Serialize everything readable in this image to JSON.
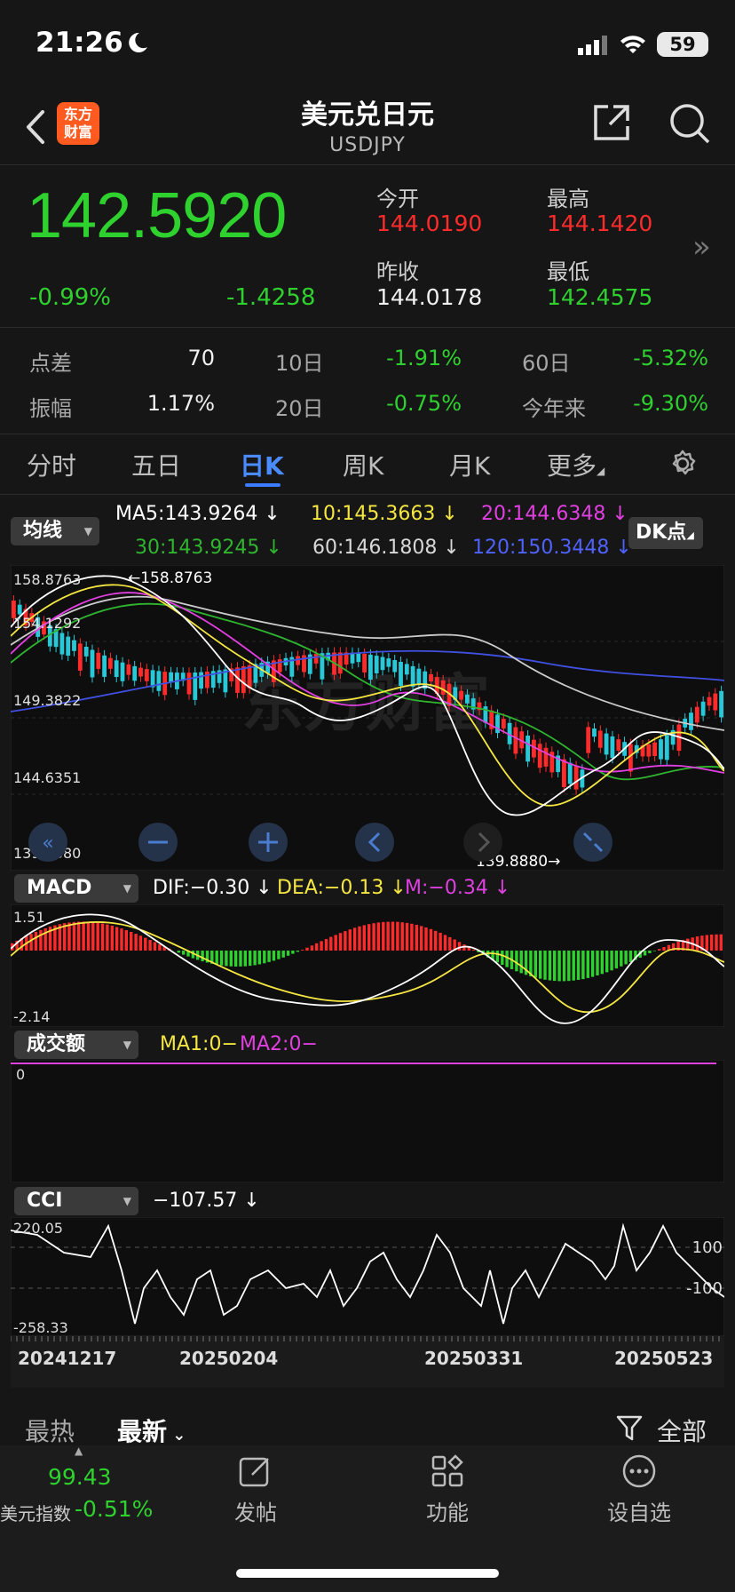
{
  "status": {
    "time": "21:26",
    "battery": "59"
  },
  "header": {
    "title": "美元兑日元",
    "subtitle": "USDJPY",
    "logo_line1": "东方",
    "logo_line2": "财富"
  },
  "quote": {
    "price": "142.5920",
    "change_pct": "-0.99%",
    "change": "-1.4258",
    "open_label": "今开",
    "open": "144.0190",
    "high_label": "最高",
    "high": "144.1420",
    "prev_close_label": "昨收",
    "prev_close": "144.0178",
    "low_label": "最低",
    "low": "142.4575"
  },
  "stats": [
    {
      "label": "点差",
      "value": "70"
    },
    {
      "label": "10日",
      "value": "-1.91%"
    },
    {
      "label": "60日",
      "value": "-5.32%"
    },
    {
      "label": "振幅",
      "value": "1.17%"
    },
    {
      "label": "20日",
      "value": "-0.75%"
    },
    {
      "label": "今年来",
      "value": "-9.30%"
    }
  ],
  "tabs": [
    "分时",
    "五日",
    "日K",
    "周K",
    "月K",
    "更多"
  ],
  "active_tab": "日K",
  "ma": {
    "selector": "均线",
    "ma5": "MA5:143.9264",
    "ma10": "10:145.3663",
    "ma20": "20:144.6348",
    "ma30": "30:143.9245",
    "ma60": "60:146.1808",
    "ma120": "120:150.3448",
    "dk_button": "DK点"
  },
  "main_chart": {
    "y_labels": [
      "158.8763",
      "154.1292",
      "149.3822",
      "144.6351",
      "139.8880"
    ],
    "max_marker": "←158.8763",
    "min_marker": "139.8880→"
  },
  "macd": {
    "selector": "MACD",
    "dif": "DIF:−0.30",
    "dea": "DEA:−0.13",
    "m": "M:−0.34",
    "y_top": "1.51",
    "y_bottom": "-2.14"
  },
  "volume": {
    "selector": "成交额",
    "ma1": "MA1:0−",
    "ma2": "MA2:0−",
    "zero": "0"
  },
  "cci": {
    "selector": "CCI",
    "value": "−107.57",
    "y_top": "220.05",
    "y_bottom": "-258.33",
    "level_upper": "100",
    "level_lower": "-100"
  },
  "dates": [
    "20241217",
    "20250204",
    "20250331",
    "20250523"
  ],
  "bottom_tabs": {
    "hot": "最热",
    "latest": "最新",
    "filter": "全部"
  },
  "bottom_nav": {
    "index_value": "99.43",
    "index_name": "美元指数",
    "index_change": "-0.51%",
    "post": "发帖",
    "functions": "功能",
    "watchlist": "设自选"
  },
  "colors": {
    "up": "#ff2b2b",
    "down": "#2fd12f",
    "accent": "#3b7bff",
    "ma5": "#ffffff",
    "ma10": "#f5e642",
    "ma20": "#e040e0",
    "ma30": "#2fb52f",
    "ma60": "#cccccc",
    "ma120": "#4050e0"
  }
}
